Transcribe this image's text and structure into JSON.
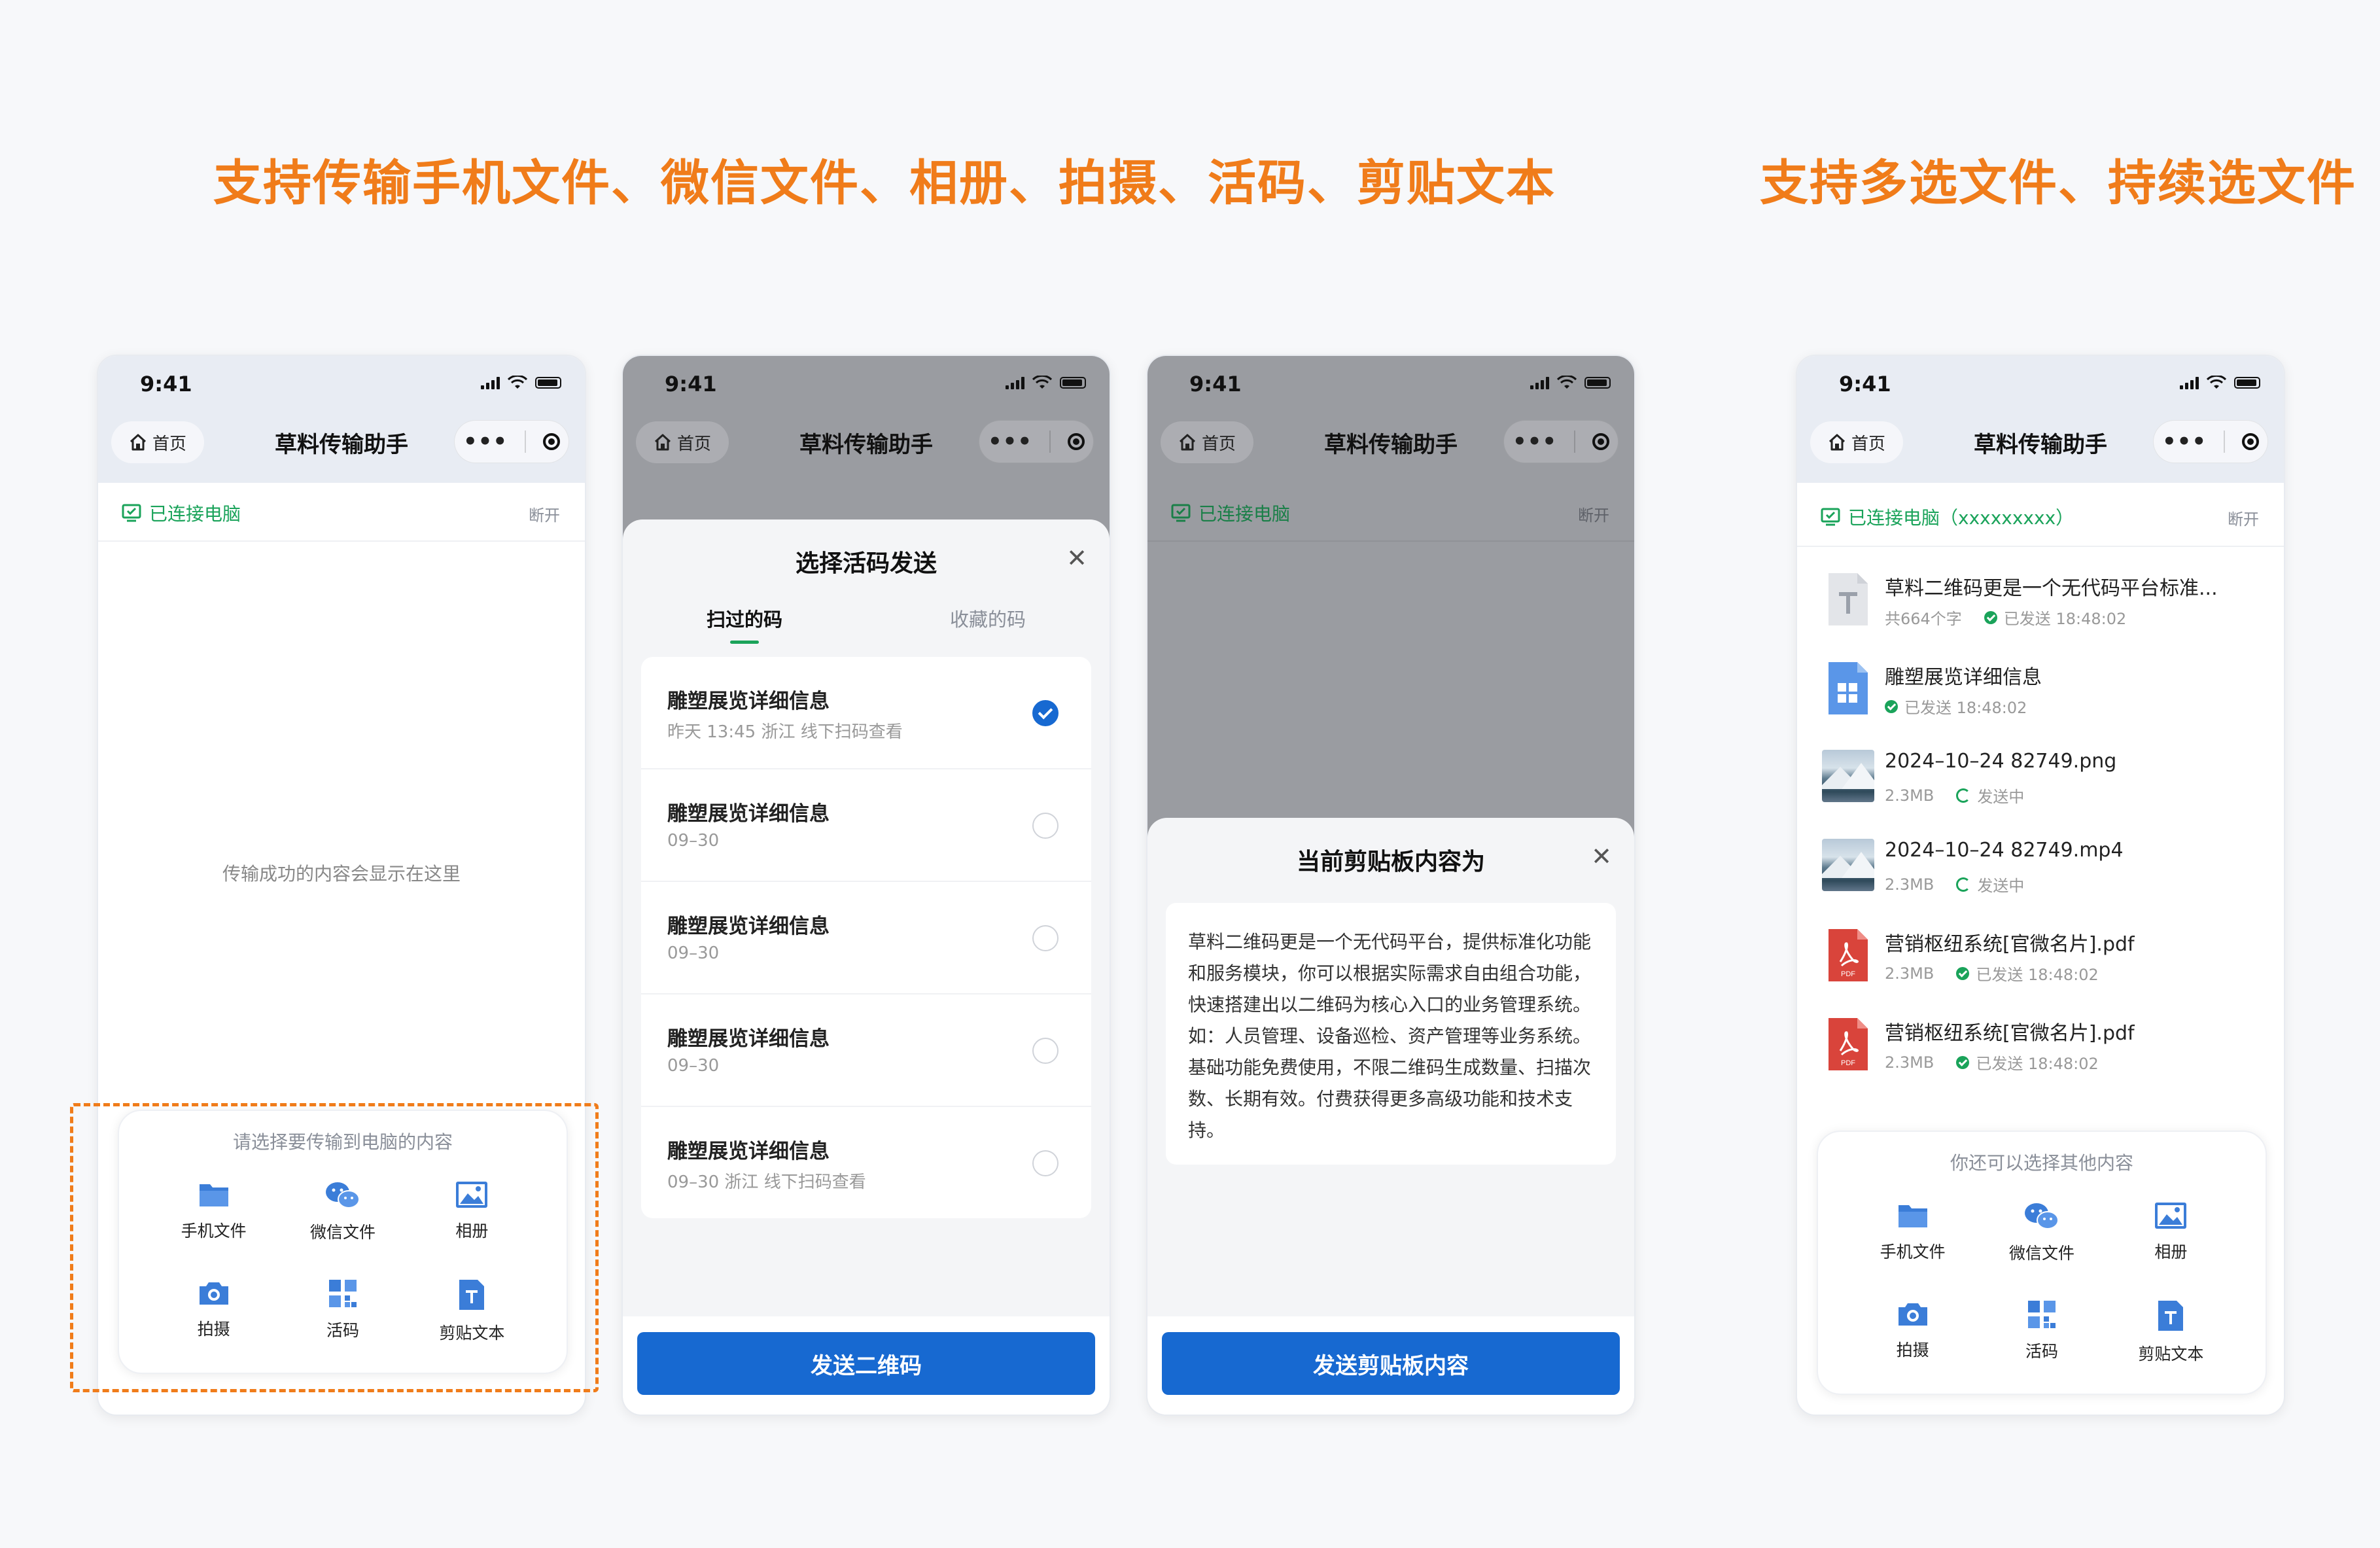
{
  "headlines": {
    "left": "支持传输手机文件、微信文件、相册、拍摄、活码、剪贴文本",
    "right": "支持多选文件、持续选文件"
  },
  "status_time": "9:41",
  "nav": {
    "home_label": "首页",
    "title": "草料传输助手"
  },
  "screen1": {
    "connected_label": "已连接电脑",
    "disconnect_label": "断开",
    "empty_tip": "传输成功的内容会显示在这里",
    "picker_title": "请选择要传输到电脑的内容"
  },
  "picker_items": [
    {
      "label": "手机文件",
      "icon": "folder-icon"
    },
    {
      "label": "微信文件",
      "icon": "wechat-icon"
    },
    {
      "label": "相册",
      "icon": "image-icon"
    },
    {
      "label": "拍摄",
      "icon": "camera-icon"
    },
    {
      "label": "活码",
      "icon": "qrcode-icon"
    },
    {
      "label": "剪贴文本",
      "icon": "text-file-icon"
    }
  ],
  "screen2": {
    "sheet_title": "选择活码发送",
    "tabs": [
      "扫过的码",
      "收藏的码"
    ],
    "rows": [
      {
        "name": "雕塑展览详细信息",
        "sub": "昨天 13:45 浙江 线下扫码查看",
        "checked": true
      },
      {
        "name": "雕塑展览详细信息",
        "sub": "09–30",
        "checked": false
      },
      {
        "name": "雕塑展览详细信息",
        "sub": "09–30",
        "checked": false
      },
      {
        "name": "雕塑展览详细信息",
        "sub": "09–30",
        "checked": false
      },
      {
        "name": "雕塑展览详细信息",
        "sub": "09–30 浙江 线下扫码查看",
        "checked": false
      }
    ],
    "button": "发送二维码"
  },
  "screen3": {
    "connected_label": "已连接电脑",
    "disconnect_label": "断开",
    "sheet_title": "当前剪贴板内容为",
    "clipboard_text": "草料二维码更是一个无代码平台，提供标准化功能和服务模块，你可以根据实际需求自由组合功能，快速搭建出以二维码为核心入口的业务管理系统。如：人员管理、设备巡检、资产管理等业务系统。基础功能免费使用，不限二维码生成数量、扫描次数、长期有效。付费获得更多高级功能和技术支持。",
    "button": "发送剪贴板内容"
  },
  "screen4": {
    "connected_label": "已连接电脑（xxxxxxxxx）",
    "disconnect_label": "断开",
    "files": [
      {
        "type": "text",
        "name": "草料二维码更是一个无代码平台标准...",
        "size": "共664个字",
        "status": "已发送 18:48:02",
        "state": "sent"
      },
      {
        "type": "qr",
        "name": "雕塑展览详细信息",
        "size": "",
        "status": "已发送 18:48:02",
        "state": "sent"
      },
      {
        "type": "image",
        "name": "2024–10–24 82749.png",
        "size": "2.3MB",
        "status": "发送中",
        "state": "sending"
      },
      {
        "type": "video",
        "name": "2024–10–24 82749.mp4",
        "size": "2.3MB",
        "status": "发送中",
        "state": "sending"
      },
      {
        "type": "pdf",
        "name": "营销枢纽系统[官微名片].pdf",
        "size": "2.3MB",
        "status": "已发送 18:48:02",
        "state": "sent"
      },
      {
        "type": "pdf",
        "name": "营销枢纽系统[官微名片].pdf",
        "size": "2.3MB",
        "status": "已发送 18:48:02",
        "state": "sent"
      }
    ],
    "picker_title": "你还可以选择其他内容"
  },
  "colors": {
    "accent_orange": "#f07c1a",
    "primary_blue": "#1769d1",
    "success_green": "#1aa35a"
  }
}
